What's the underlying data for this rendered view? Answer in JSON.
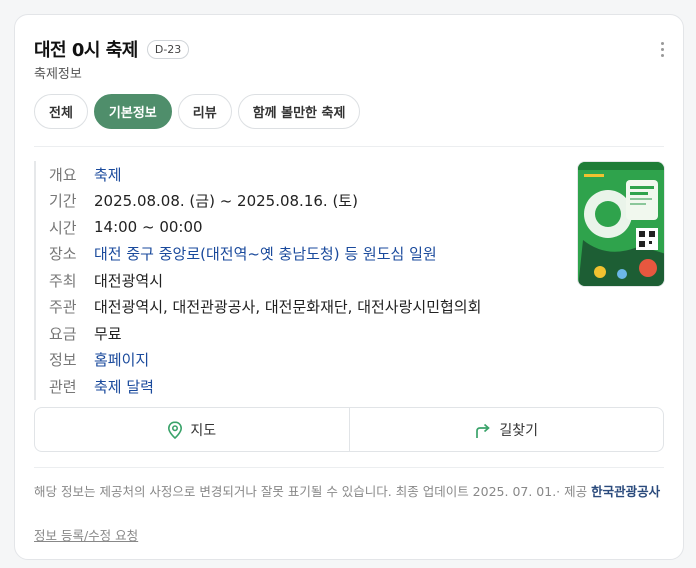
{
  "header": {
    "title": "대전 0시 축제",
    "dday": "D-23",
    "subtitle": "축제정보"
  },
  "tabs": [
    {
      "label": "전체",
      "active": false
    },
    {
      "label": "기본정보",
      "active": true
    },
    {
      "label": "리뷰",
      "active": false
    },
    {
      "label": "함께 볼만한 축제",
      "active": false
    }
  ],
  "info": [
    {
      "label": "개요",
      "value": "축제",
      "link": true
    },
    {
      "label": "기간",
      "value": "2025.08.08. (금) ~  2025.08.16. (토)",
      "link": false
    },
    {
      "label": "시간",
      "value": "14:00 ~ 00:00",
      "link": false
    },
    {
      "label": "장소",
      "value": "대전 중구 중앙로(대전역~옛 충남도청) 등 원도심 일원",
      "link": true
    },
    {
      "label": "주최",
      "value": "대전광역시",
      "link": false
    },
    {
      "label": "주관",
      "value": "대전광역시, 대전관광공사, 대전문화재단, 대전사랑시민협의회",
      "link": false
    },
    {
      "label": "요금",
      "value": "무료",
      "link": false
    },
    {
      "label": "정보",
      "value": "홈페이지",
      "link": true
    },
    {
      "label": "관련",
      "value": "축제 달력",
      "link": true
    }
  ],
  "actions": {
    "map": "지도",
    "directions": "길찾기"
  },
  "notice": {
    "text": "해당 정보는 제공처의 사정으로 변경되거나 잘못 표기될 수 있습니다. 최종 업데이트 2025. 07. 01.· 제공 ",
    "source": "한국관광공사"
  },
  "report": "정보 등록/수정 요청",
  "colors": {
    "accent": "#4f8e6b",
    "link": "#1a4a9c"
  }
}
